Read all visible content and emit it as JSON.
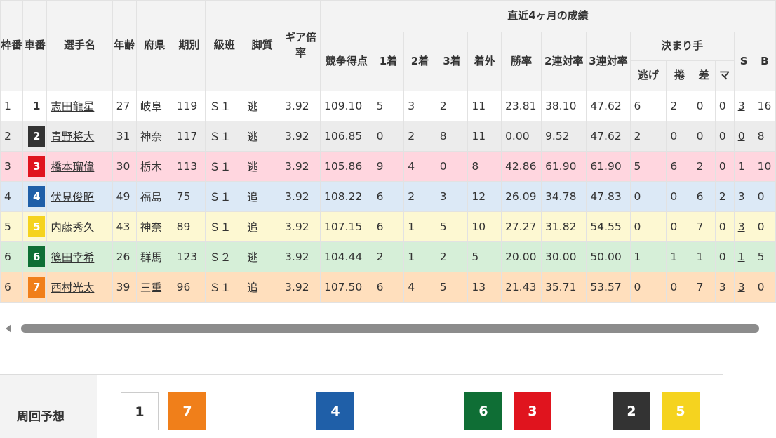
{
  "headers": {
    "waku": "枠番",
    "sha": "車番",
    "name": "選手名",
    "age": "年齢",
    "pref": "府県",
    "term": "期別",
    "class": "級班",
    "style": "脚質",
    "gear": "ギア倍率",
    "recent": "直近4ヶ月の成績",
    "score": "競争得点",
    "first": "1着",
    "second": "2着",
    "third": "3着",
    "out": "着外",
    "win_rate": "勝率",
    "rate2": "2連対率",
    "rate3": "3連対率",
    "kimarite": "決まり手",
    "nige": "逃げ",
    "makuri": "捲",
    "sashi": "差",
    "ma": "マ",
    "s": "S",
    "b": "B"
  },
  "rows": [
    {
      "waku": "1",
      "car": "1",
      "name": "志田龍星",
      "age": "27",
      "pref": "岐阜",
      "term": "119",
      "class": "Ｓ１",
      "style": "逃",
      "gear": "3.92",
      "score": "109.10",
      "c1": "5",
      "c2": "3",
      "c3": "2",
      "out": "11",
      "win": "23.81",
      "r2": "38.10",
      "r3": "47.62",
      "nige": "6",
      "makuri": "2",
      "sashi": "0",
      "ma": "0",
      "s": "3",
      "b": "16"
    },
    {
      "waku": "2",
      "car": "2",
      "name": "青野将大",
      "age": "31",
      "pref": "神奈",
      "term": "117",
      "class": "Ｓ１",
      "style": "逃",
      "gear": "3.92",
      "score": "106.85",
      "c1": "0",
      "c2": "2",
      "c3": "8",
      "out": "11",
      "win": "0.00",
      "r2": "9.52",
      "r3": "47.62",
      "nige": "2",
      "makuri": "0",
      "sashi": "0",
      "ma": "0",
      "s": "0",
      "b": "8"
    },
    {
      "waku": "3",
      "car": "3",
      "name": "橋本瑠偉",
      "age": "30",
      "pref": "栃木",
      "term": "113",
      "class": "Ｓ１",
      "style": "逃",
      "gear": "3.92",
      "score": "105.86",
      "c1": "9",
      "c2": "4",
      "c3": "0",
      "out": "8",
      "win": "42.86",
      "r2": "61.90",
      "r3": "61.90",
      "nige": "5",
      "makuri": "6",
      "sashi": "2",
      "ma": "0",
      "s": "1",
      "b": "10"
    },
    {
      "waku": "4",
      "car": "4",
      "name": "伏見俊昭",
      "age": "49",
      "pref": "福島",
      "term": "75",
      "class": "Ｓ１",
      "style": "追",
      "gear": "3.92",
      "score": "108.22",
      "c1": "6",
      "c2": "2",
      "c3": "3",
      "out": "12",
      "win": "26.09",
      "r2": "34.78",
      "r3": "47.83",
      "nige": "0",
      "makuri": "0",
      "sashi": "6",
      "ma": "2",
      "s": "3",
      "b": "0"
    },
    {
      "waku": "5",
      "car": "5",
      "name": "内藤秀久",
      "age": "43",
      "pref": "神奈",
      "term": "89",
      "class": "Ｓ１",
      "style": "追",
      "gear": "3.92",
      "score": "107.15",
      "c1": "6",
      "c2": "1",
      "c3": "5",
      "out": "10",
      "win": "27.27",
      "r2": "31.82",
      "r3": "54.55",
      "nige": "0",
      "makuri": "0",
      "sashi": "7",
      "ma": "0",
      "s": "3",
      "b": "0"
    },
    {
      "waku": "6",
      "car": "6",
      "name": "篠田幸希",
      "age": "26",
      "pref": "群馬",
      "term": "123",
      "class": "Ｓ２",
      "style": "逃",
      "gear": "3.92",
      "score": "104.44",
      "c1": "2",
      "c2": "1",
      "c3": "2",
      "out": "5",
      "win": "20.00",
      "r2": "30.00",
      "r3": "50.00",
      "nige": "1",
      "makuri": "1",
      "sashi": "1",
      "ma": "0",
      "s": "1",
      "b": "5"
    },
    {
      "waku": "6",
      "car": "7",
      "name": "西村光太",
      "age": "39",
      "pref": "三重",
      "term": "96",
      "class": "Ｓ１",
      "style": "追",
      "gear": "3.92",
      "score": "107.50",
      "c1": "6",
      "c2": "4",
      "c3": "5",
      "out": "13",
      "win": "21.43",
      "r2": "35.71",
      "r3": "53.57",
      "nige": "0",
      "makuri": "0",
      "sashi": "7",
      "ma": "3",
      "s": "3",
      "b": "0"
    }
  ],
  "car_colors": {
    "1": {
      "bg": "#ffffff",
      "fg": "#333333"
    },
    "2": {
      "bg": "#333333",
      "fg": "#ffffff"
    },
    "3": {
      "bg": "#e0141e",
      "fg": "#ffffff"
    },
    "4": {
      "bg": "#1f5fa8",
      "fg": "#ffffff"
    },
    "5": {
      "bg": "#f5d31f",
      "fg": "#ffffff"
    },
    "6": {
      "bg": "#0f6e35",
      "fg": "#ffffff"
    },
    "7": {
      "bg": "#f07f1a",
      "fg": "#ffffff"
    }
  },
  "forecast": {
    "label": "周回予想",
    "boxes": [
      {
        "num": "1",
        "bg": "#ffffff",
        "fg": "#333333"
      },
      {
        "num": "7",
        "bg": "#f07f1a",
        "fg": "#ffffff"
      },
      {
        "num": "4",
        "bg": "#1f5fa8",
        "fg": "#ffffff"
      },
      {
        "num": "6",
        "bg": "#0f6e35",
        "fg": "#ffffff"
      },
      {
        "num": "3",
        "bg": "#e0141e",
        "fg": "#ffffff"
      },
      {
        "num": "2",
        "bg": "#333333",
        "fg": "#ffffff"
      },
      {
        "num": "5",
        "bg": "#f5d31f",
        "fg": "#ffffff"
      }
    ]
  }
}
